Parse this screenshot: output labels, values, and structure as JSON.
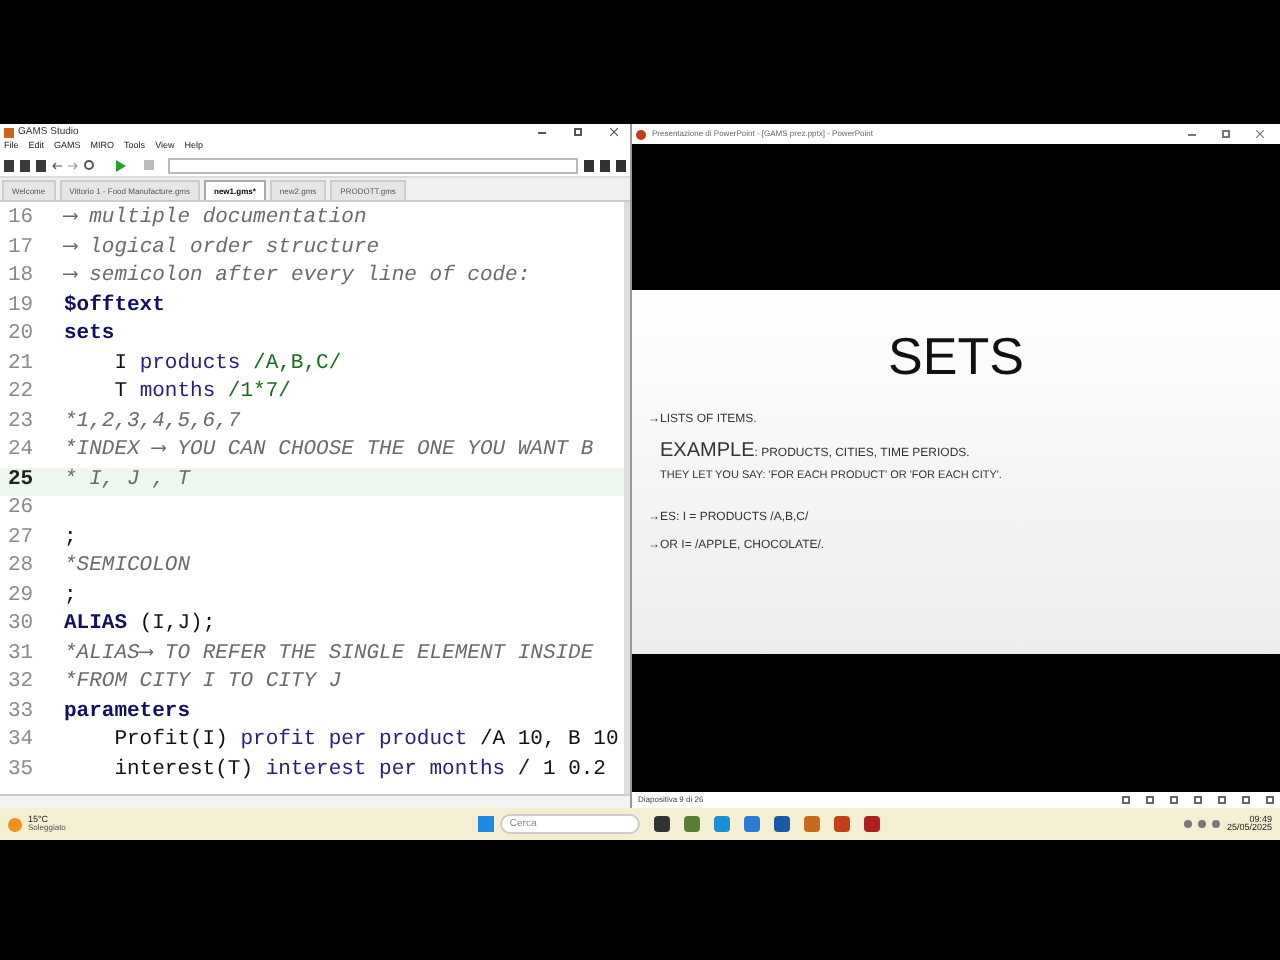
{
  "gams_window": {
    "title": "GAMS Studio",
    "menu": [
      "File",
      "Edit",
      "GAMS",
      "MIRO",
      "Tools",
      "View",
      "Help"
    ],
    "tabs": [
      {
        "label": "Welcome",
        "selected": false
      },
      {
        "label": "Vittorio 1 - Food Manufacture.gms",
        "selected": false
      },
      {
        "label": "new1.gms*",
        "selected": true
      },
      {
        "label": "new2.gms",
        "selected": false
      },
      {
        "label": "PRODOTT.gms",
        "selected": false
      }
    ],
    "editor": {
      "lines": [
        {
          "number": "16",
          "selected": false,
          "segments": [
            {
              "kind": "comment",
              "text": "⟶ multiple documentation"
            }
          ]
        },
        {
          "number": "17",
          "selected": false,
          "segments": [
            {
              "kind": "comment",
              "text": "⟶ logical order structure"
            }
          ]
        },
        {
          "number": "18",
          "selected": false,
          "segments": [
            {
              "kind": "comment",
              "text": "⟶ semicolon after every line of code:"
            }
          ]
        },
        {
          "number": "19",
          "selected": false,
          "segments": [
            {
              "kind": "keyword",
              "text": "$offtext"
            }
          ]
        },
        {
          "number": "20",
          "selected": false,
          "segments": [
            {
              "kind": "keyword",
              "text": "sets"
            }
          ]
        },
        {
          "number": "21",
          "selected": false,
          "segments": [
            {
              "kind": "text",
              "text": "    I "
            },
            {
              "kind": "description",
              "text": "products "
            },
            {
              "kind": "data",
              "text": "/A,B,C/"
            }
          ]
        },
        {
          "number": "22",
          "selected": false,
          "segments": [
            {
              "kind": "text",
              "text": "    T "
            },
            {
              "kind": "description",
              "text": "months "
            },
            {
              "kind": "data",
              "text": "/1*7/"
            }
          ]
        },
        {
          "number": "23",
          "selected": false,
          "segments": [
            {
              "kind": "comment",
              "text": "*1,2,3,4,5,6,7"
            }
          ]
        },
        {
          "number": "24",
          "selected": false,
          "segments": [
            {
              "kind": "comment",
              "text": "*INDEX ⟶ YOU CAN CHOOSE THE ONE YOU WANT B"
            }
          ]
        },
        {
          "number": "25",
          "selected": true,
          "segments": [
            {
              "kind": "comment",
              "text": "* I, J , T"
            }
          ]
        },
        {
          "number": "26",
          "selected": false
        },
        {
          "number": "27",
          "selected": false,
          "segments": [
            {
              "kind": "text",
              "text": ";"
            }
          ]
        },
        {
          "number": "28",
          "selected": false,
          "segments": [
            {
              "kind": "comment",
              "text": "*SEMICOLON"
            }
          ]
        },
        {
          "number": "29",
          "selected": false,
          "segments": [
            {
              "kind": "text",
              "text": ";"
            }
          ]
        },
        {
          "number": "30",
          "selected": false,
          "segments": [
            {
              "kind": "keyword",
              "text": "ALIAS"
            },
            {
              "kind": "text",
              "text": " (I,J);"
            }
          ]
        },
        {
          "number": "31",
          "selected": false,
          "segments": [
            {
              "kind": "comment",
              "text": "*ALIAS⟶ TO REFER THE SINGLE ELEMENT INSIDE"
            }
          ]
        },
        {
          "number": "32",
          "selected": false,
          "segments": [
            {
              "kind": "comment",
              "text": "*FROM CITY I TO CITY J"
            }
          ]
        },
        {
          "number": "33",
          "selected": false,
          "segments": [
            {
              "kind": "keyword",
              "text": "parameters"
            }
          ]
        },
        {
          "number": "34",
          "selected": false,
          "segments": [
            {
              "kind": "text",
              "text": "    Profit(I) "
            },
            {
              "kind": "description",
              "text": "profit per product "
            },
            {
              "kind": "text",
              "text": "/A 10, B 10"
            }
          ]
        },
        {
          "number": "35",
          "selected": false,
          "segments": [
            {
              "kind": "text",
              "text": "    interest(T) "
            },
            {
              "kind": "description",
              "text": "interest per months "
            },
            {
              "kind": "text",
              "text": "/ 1 0.2"
            }
          ]
        }
      ]
    }
  },
  "ppt_window": {
    "title": "Presentazione di PowerPoint - [GAMS prez.pptx] - PowerPoint",
    "slide": {
      "title": "SETS",
      "lines": [
        {
          "kind": "bullet",
          "text": "→LISTS OF ITEMS."
        },
        {
          "kind": "example",
          "lead": "EXAMPLE",
          "text": ": PRODUCTS, CITIES, TIME PERIODS."
        },
        {
          "kind": "plain",
          "text": "THEY LET YOU SAY: 'FOR EACH PRODUCT' OR 'FOR EACH CITY'."
        },
        {
          "kind": "gap"
        },
        {
          "kind": "bullet",
          "text": "→ES:  I = PRODUCTS /A,B,C/"
        },
        {
          "kind": "bullet",
          "text": "→OR I= /APPLE, CHOCOLATE/."
        }
      ]
    },
    "status": "Diapositiva 9 di 26"
  },
  "taskbar": {
    "temperature": "15°C",
    "weather": "Soleggiato",
    "search": {
      "placeholder": "Cerca"
    },
    "time": "09:49",
    "date": "25/05/2025"
  }
}
